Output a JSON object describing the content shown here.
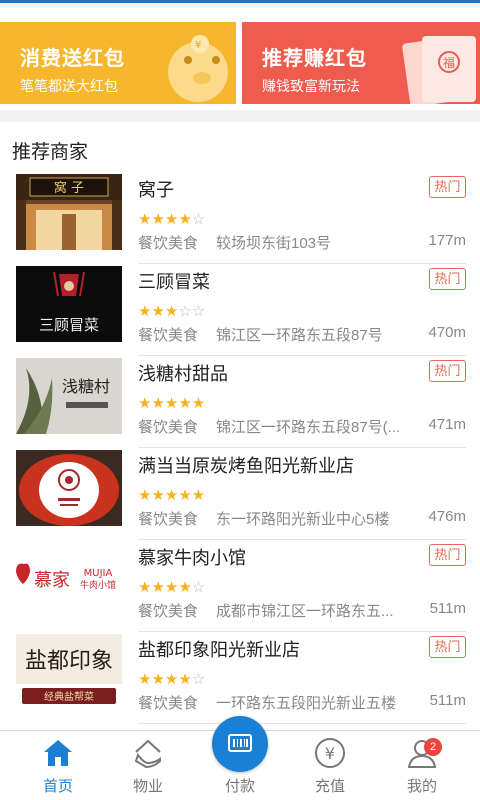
{
  "banners": [
    {
      "title": "消费送红包",
      "subtitle": "笔笔都送大红包"
    },
    {
      "title": "推荐赚红包",
      "subtitle": "赚钱致富新玩法"
    }
  ],
  "section_title": "推荐商家",
  "hot_label": "热门",
  "merchants": [
    {
      "name": "窝子",
      "rating": 4,
      "category": "餐饮美食",
      "address": "较场坝东街103号",
      "distance": "177m",
      "hot": true
    },
    {
      "name": "三顾冒菜",
      "rating": 3,
      "category": "餐饮美食",
      "address": "锦江区一环路东五段87号",
      "distance": "470m",
      "hot": true
    },
    {
      "name": "浅糖村甜品",
      "rating": 5,
      "category": "餐饮美食",
      "address": "锦江区一环路东五段87号(...",
      "distance": "471m",
      "hot": true
    },
    {
      "name": "满当当原炭烤鱼阳光新业店",
      "rating": 5,
      "category": "餐饮美食",
      "address": "东一环路阳光新业中心5楼",
      "distance": "476m",
      "hot": false
    },
    {
      "name": "慕家牛肉小馆",
      "rating": 4,
      "category": "餐饮美食",
      "address": "成都市锦江区一环路东五...",
      "distance": "511m",
      "hot": true
    },
    {
      "name": "盐都印象阳光新业店",
      "rating": 4,
      "category": "餐饮美食",
      "address": "一环路东五段阳光新业五楼",
      "distance": "511m",
      "hot": true
    }
  ],
  "thumb_text": {
    "wozi": "窝 子",
    "sangu": "三顾冒菜",
    "qiantang": "浅糖村",
    "mujia_cn": "慕家",
    "mujia_en": "MUJIA",
    "mujia_sub": "牛肉小馆",
    "yandu": "盐都印象",
    "yandu_sub": "经典盐帮菜"
  },
  "tabs": [
    {
      "label": "首页",
      "icon": "home-icon",
      "active": true
    },
    {
      "label": "物业",
      "icon": "property-icon",
      "active": false
    },
    {
      "label": "付款",
      "icon": "pay-icon",
      "active": false
    },
    {
      "label": "充值",
      "icon": "recharge-icon",
      "active": false
    },
    {
      "label": "我的",
      "icon": "profile-icon",
      "active": false
    }
  ],
  "profile_badge": "2",
  "colors": {
    "accent": "#1b80d4",
    "banner_left": "#f6b72f",
    "banner_right": "#ef5b4d",
    "star": "#f6b221",
    "hot": "#e56b5c"
  }
}
